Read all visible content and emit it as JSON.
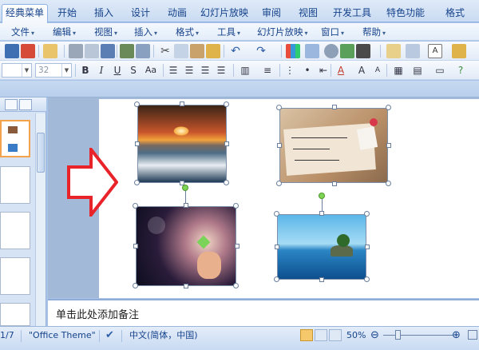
{
  "ribbon": {
    "tabs": [
      "经典菜单",
      "开始",
      "插入",
      "设计",
      "动画",
      "幻灯片放映",
      "审阅",
      "视图",
      "开发工具",
      "特色功能",
      "格式"
    ],
    "active_tab": 0
  },
  "menubar": {
    "items": [
      "文件",
      "编辑",
      "视图",
      "插入",
      "格式",
      "工具",
      "幻灯片放映",
      "窗口",
      "帮助"
    ]
  },
  "toolbar": {
    "font_size_value": "32",
    "format_buttons": [
      "B",
      "I",
      "U",
      "S",
      "Aa"
    ]
  },
  "slides_pane": {
    "thumbnail_count": 5,
    "selected_index": 0
  },
  "notes": {
    "placeholder": "单击此处添加备注"
  },
  "statusbar": {
    "slide_counter": "1/7",
    "theme": "\"Office Theme\"",
    "language": "中文(简体，中国)",
    "zoom": "50%"
  },
  "colors": {
    "arrow": "#e8232a",
    "selection_accent": "#f3a34b",
    "ribbon_text": "#15428b"
  }
}
